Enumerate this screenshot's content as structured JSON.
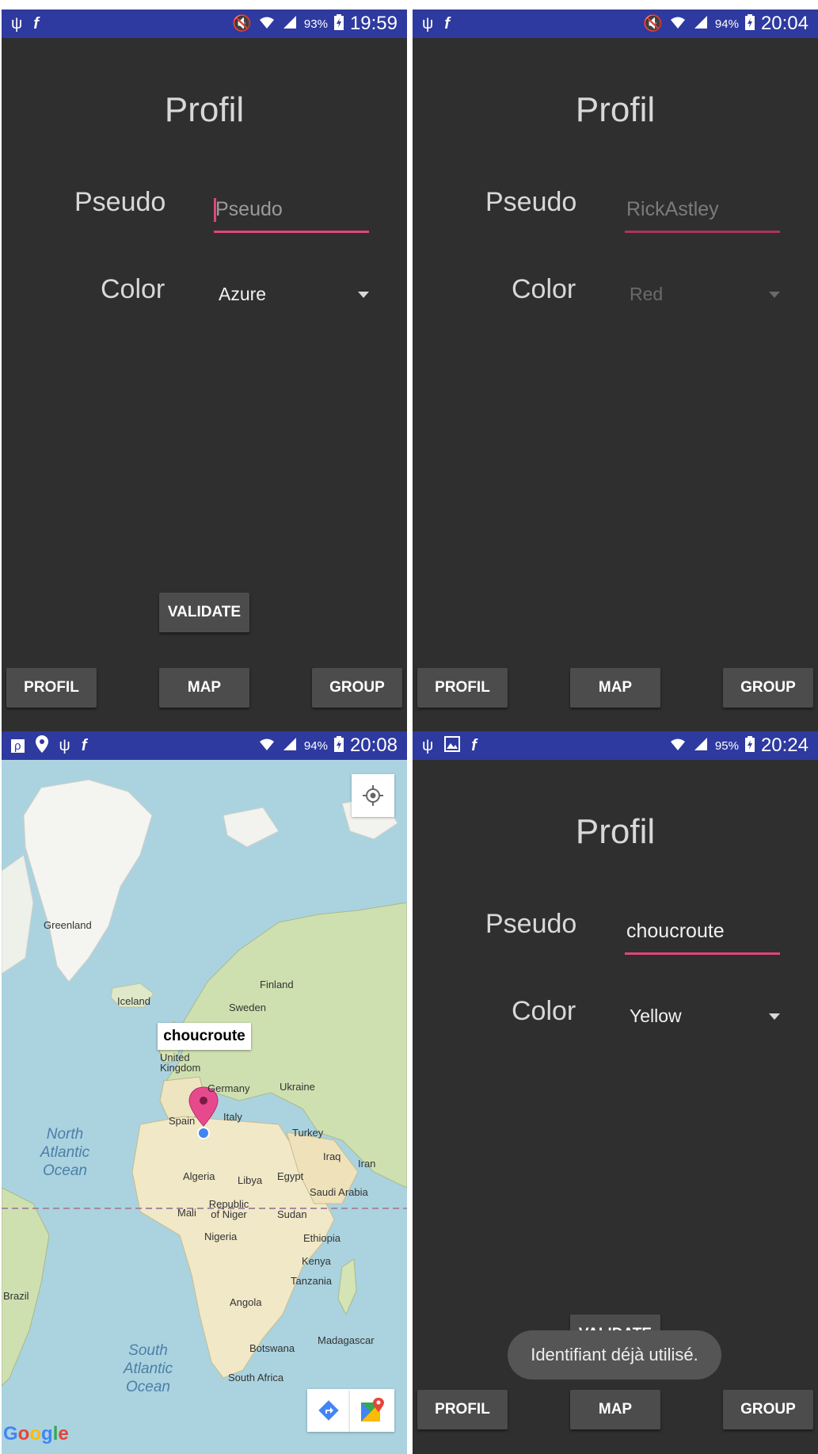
{
  "screens": [
    {
      "status": {
        "battery": "93%",
        "time": "19:59"
      },
      "title": "Profil",
      "pseudo_label": "Pseudo",
      "pseudo_value": "",
      "pseudo_placeholder": "Pseudo",
      "color_label": "Color",
      "color_value": "Azure",
      "validate": "VALIDATE",
      "nav": {
        "profil": "PROFIL",
        "map": "MAP",
        "group": "GROUP"
      }
    },
    {
      "status": {
        "battery": "94%",
        "time": "20:04"
      },
      "title": "Profil",
      "pseudo_label": "Pseudo",
      "pseudo_value": "RickAstley",
      "color_label": "Color",
      "color_value": "Red",
      "nav": {
        "profil": "PROFIL",
        "map": "MAP",
        "group": "GROUP"
      }
    },
    {
      "status": {
        "battery": "94%",
        "time": "20:08"
      },
      "map": {
        "marker_title": "choucroute",
        "labels": [
          "Greenland",
          "Iceland",
          "Finland",
          "Sweden",
          "United Kingdom",
          "Germany",
          "Ukraine",
          "Spain",
          "Italy",
          "Turkey",
          "Iraq",
          "Iran",
          "Algeria",
          "Libya",
          "Egypt",
          "Saudi Arabia",
          "Mali",
          "Republic of Niger",
          "Sudan",
          "Nigeria",
          "Ethiopia",
          "Kenya",
          "Tanzania",
          "Angola",
          "Brazil",
          "Botswana",
          "Madagascar",
          "South Africa"
        ],
        "oceans": [
          "North Atlantic Ocean",
          "South Atlantic Ocean"
        ],
        "logo": "Google"
      }
    },
    {
      "status": {
        "battery": "95%",
        "time": "20:24"
      },
      "title": "Profil",
      "pseudo_label": "Pseudo",
      "pseudo_value": "choucroute",
      "color_label": "Color",
      "color_value": "Yellow",
      "validate": "VALIDATE",
      "toast": "Identifiant déjà utilisé.",
      "nav": {
        "profil": "PROFIL",
        "map": "MAP",
        "group": "GROUP"
      }
    }
  ],
  "icons": [
    "usb-icon",
    "flipboard-icon",
    "mute-icon",
    "wifi-icon",
    "signal-icon",
    "battery-charging-icon",
    "location-icon",
    "image-icon",
    "my-location-icon",
    "directions-icon",
    "google-maps-icon"
  ]
}
